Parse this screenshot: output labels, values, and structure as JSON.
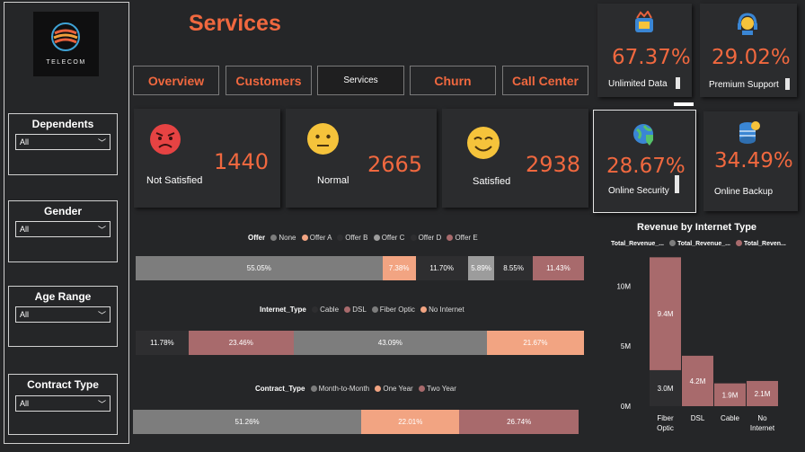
{
  "logo": {
    "text": "TELECOM"
  },
  "filters": [
    {
      "title": "Dependents",
      "value": "All"
    },
    {
      "title": "Gender",
      "value": "All"
    },
    {
      "title": "Age Range",
      "value": "All"
    },
    {
      "title": "Contract Type",
      "value": "All"
    }
  ],
  "page_title": "Services",
  "tabs": [
    "Overview",
    "Customers",
    "Services",
    "Churn",
    "Call Center"
  ],
  "satisfaction": [
    {
      "label": "Not Satisfied",
      "value": "1440",
      "icon": "angry-face-icon"
    },
    {
      "label": "Normal",
      "value": "2665",
      "icon": "neutral-face-icon"
    },
    {
      "label": "Satisfied",
      "value": "2938",
      "icon": "smiling-face-icon"
    }
  ],
  "service_kpis": [
    {
      "label": "Unlimited Data",
      "value": "67.37%",
      "icon": "data-icon"
    },
    {
      "label": "Premium Support",
      "value": "29.02%",
      "icon": "headset-icon"
    },
    {
      "label": "Online Security",
      "value": "28.67%",
      "icon": "shield-globe-icon"
    },
    {
      "label": "Online Backup",
      "value": "34.49%",
      "icon": "database-icon"
    }
  ],
  "colors": {
    "accent": "#f0683f",
    "gray": "#7d7d7d",
    "peach": "#f2a482",
    "rose": "#a86a6c",
    "dark": "#2e2e30"
  },
  "chart_data": [
    {
      "type": "bar",
      "legend_title": "Offer",
      "series": [
        {
          "name": "None",
          "value": 55.05,
          "label": "55.05%",
          "color": "#7d7d7d"
        },
        {
          "name": "Offer A",
          "value": 7.38,
          "label": "7.38%",
          "color": "#f2a482"
        },
        {
          "name": "Offer B",
          "value": 11.7,
          "label": "11.70%",
          "color": "#2e2e30"
        },
        {
          "name": "Offer C",
          "value": 5.89,
          "label": "5.89%",
          "color": "#9c9c9c"
        },
        {
          "name": "Offer D",
          "value": 8.55,
          "label": "8.55%",
          "color": "#2e2e30"
        },
        {
          "name": "Offer E",
          "value": 11.43,
          "label": "11.43%",
          "color": "#a86a6c"
        }
      ]
    },
    {
      "type": "bar",
      "legend_title": "Internet_Type",
      "series": [
        {
          "name": "Cable",
          "value": 11.78,
          "label": "11.78%",
          "color": "#2e2e30"
        },
        {
          "name": "DSL",
          "value": 23.46,
          "label": "23.46%",
          "color": "#a86a6c"
        },
        {
          "name": "Fiber Optic",
          "value": 43.09,
          "label": "43.09%",
          "color": "#7d7d7d"
        },
        {
          "name": "No Internet",
          "value": 21.67,
          "label": "21.67%",
          "color": "#f2a482"
        }
      ]
    },
    {
      "type": "bar",
      "legend_title": "Contract_Type",
      "series": [
        {
          "name": "Month-to-Month",
          "value": 51.26,
          "label": "51.26%",
          "color": "#7d7d7d"
        },
        {
          "name": "One Year",
          "value": 22.01,
          "label": "22.01%",
          "color": "#f2a482"
        },
        {
          "name": "Two Year",
          "value": 26.74,
          "label": "26.74%",
          "color": "#a86a6c"
        }
      ]
    },
    {
      "type": "bar",
      "title": "Revenue by Internet Type",
      "legend": [
        "Total_Revenue_...",
        "Total_Revenue_...",
        "Total_Reven..."
      ],
      "categories": [
        "Fiber Optic",
        "DSL",
        "Cable",
        "No Internet"
      ],
      "category_lines": [
        [
          "Fiber",
          "Optic"
        ],
        [
          "DSL"
        ],
        [
          "Cable"
        ],
        [
          "No",
          "Internet"
        ]
      ],
      "series": [
        {
          "name": "Total_Revenue_...",
          "values": [
            3.0,
            0,
            0,
            0
          ],
          "labels": [
            "3.0M",
            "",
            "",
            ""
          ],
          "color": "#2e2e30"
        },
        {
          "name": "Total_Revenue_...",
          "values": [
            0,
            0,
            0,
            0
          ],
          "labels": [
            "",
            "",
            "",
            ""
          ],
          "color": "#7d7d7d"
        },
        {
          "name": "Total_Reven...",
          "values": [
            9.4,
            4.2,
            1.9,
            2.1
          ],
          "labels": [
            "9.4M",
            "4.2M",
            "1.9M",
            "2.1M"
          ],
          "color": "#a86a6c"
        }
      ],
      "yticks": [
        "0M",
        "5M",
        "10M"
      ],
      "ytick_values": [
        0,
        5,
        10
      ],
      "ylim": [
        0,
        12.5
      ]
    }
  ]
}
